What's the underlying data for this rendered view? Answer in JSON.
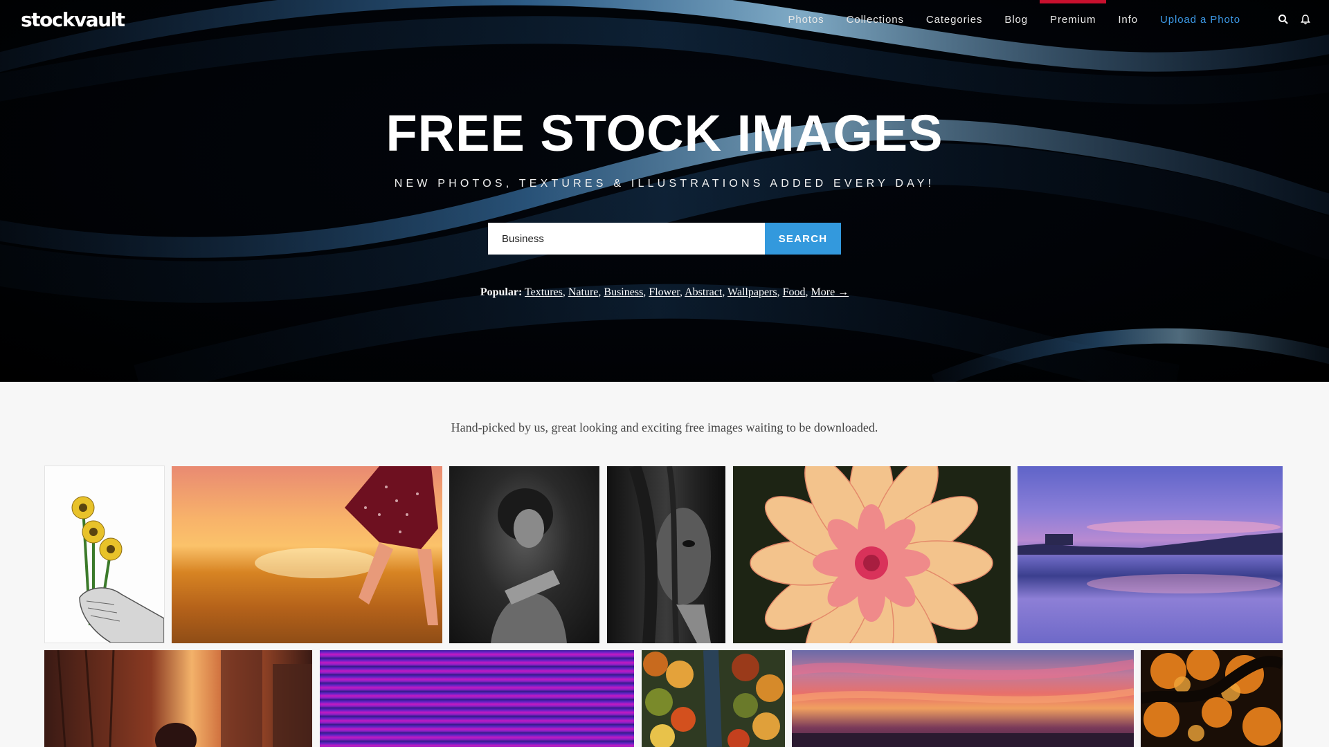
{
  "logo": "stockvault",
  "nav": {
    "items": [
      {
        "label": "Photos"
      },
      {
        "label": "Collections"
      },
      {
        "label": "Categories"
      },
      {
        "label": "Blog"
      },
      {
        "label": "Premium"
      },
      {
        "label": "Info"
      },
      {
        "label": "Upload a Photo"
      }
    ],
    "active_item": "Premium",
    "icons": [
      "search-icon",
      "bell-icon"
    ]
  },
  "hero": {
    "title": "FREE STOCK IMAGES",
    "subtitle": "NEW PHOTOS, TEXTURES & ILLUSTRATIONS ADDED EVERY DAY!",
    "search": {
      "value": "Business",
      "button_label": "SEARCH"
    },
    "popular_label": "Popular:",
    "popular_links": [
      "Textures",
      "Nature",
      "Business",
      "Flower",
      "Abstract",
      "Wallpapers",
      "Food",
      "More →"
    ]
  },
  "tagline": "Hand-picked by us, great looking and exciting free images waiting to be downloaded.",
  "colors": {
    "accent_blue": "#3399dd",
    "active_red": "#c8102e",
    "hero_bg": "#000000",
    "page_bg": "#f7f7f7"
  }
}
